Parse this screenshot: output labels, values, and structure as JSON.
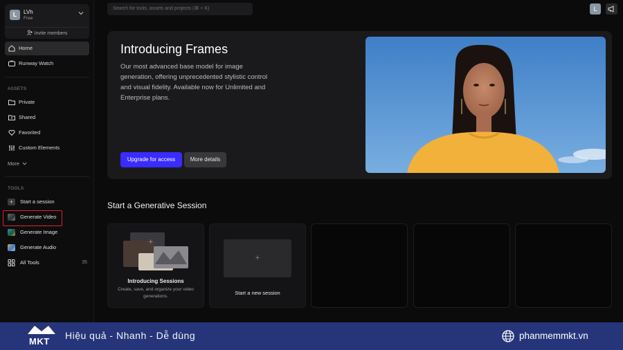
{
  "account": {
    "initial": "L",
    "name": "LVh",
    "plan": "Free",
    "invite": "Invite members"
  },
  "nav": {
    "home": "Home",
    "runway_watch": "Runway Watch"
  },
  "assets": {
    "label": "ASSETS",
    "private": "Private",
    "shared": "Shared",
    "favorited": "Favorited",
    "custom_elements": "Custom Elements",
    "more": "More"
  },
  "tools": {
    "label": "TOOLS",
    "start_session": "Start a session",
    "generate_video": "Generate Video",
    "generate_image": "Generate Image",
    "generate_audio": "Generate Audio",
    "all_tools": "All Tools",
    "all_tools_count": "35"
  },
  "search": {
    "placeholder": "Search for tools, assets and projects (⌘ + K)"
  },
  "topbar": {
    "avatar_initial": "L"
  },
  "hero": {
    "title": "Introducing Frames",
    "description": "Our most advanced base model for image generation, offering unprecedented stylistic control and visual fidelity. Available now for Unlimited and Enterprise plans.",
    "upgrade_label": "Upgrade for access",
    "more_label": "More details"
  },
  "sessions": {
    "title": "Start a Generative Session",
    "intro_title": "Introducing Sessions",
    "intro_desc": "Create, save, and organize your video generations.",
    "new_plus": "+",
    "new_label": "Start a new session"
  },
  "banner": {
    "logo_text": "MKT",
    "slogan": "Hiệu quả - Nhanh - Dễ dùng",
    "site": "phanmemmkt.vn"
  },
  "colors": {
    "accent": "#3b2bff",
    "highlight": "#e0242c",
    "banner": "#26357a"
  }
}
